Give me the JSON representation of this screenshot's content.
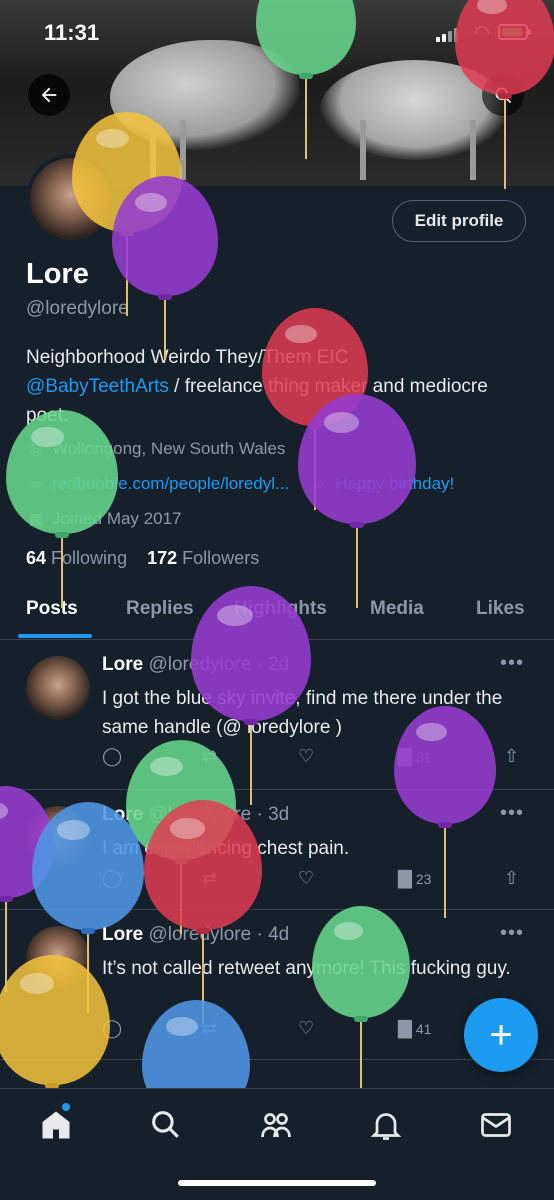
{
  "status_bar": {
    "time": "11:31"
  },
  "profile": {
    "name": "Lore",
    "handle": "@loredylore",
    "edit_label": "Edit profile",
    "bio_line1": "Neighborhood Weirdo They/Them EIC",
    "bio_mention": "@BabyTeethArts",
    "bio_rest": " / freelance thing maker and mediocre poet.",
    "location": "Wollongong, New South Wales",
    "website": "redbubble.com/people/loredyl...",
    "birthday": "Happy birthday!",
    "joined": "Joined May 2017",
    "following_count": "64",
    "following_label": "Following",
    "followers_count": "172",
    "followers_label": "Followers"
  },
  "tabs": [
    {
      "label": "Posts",
      "active": true
    },
    {
      "label": "Replies"
    },
    {
      "label": "Highlights"
    },
    {
      "label": "Media"
    },
    {
      "label": "Likes"
    }
  ],
  "posts": [
    {
      "name": "Lore",
      "handle": "@loredylore",
      "time": "2d",
      "text": "I got the blue sky invite, find me there under the same handle (@ loredylore )",
      "views": "31"
    },
    {
      "name": "Lore",
      "handle": "@loredylore",
      "time": "3d",
      "text": "I am experiencing chest pain.",
      "views": "23"
    },
    {
      "name": "Lore",
      "handle": "@loredylore",
      "time": "4d",
      "text": "It’s not called retweet anymore! This fucking guy.",
      "views": "41"
    }
  ],
  "icons": {
    "back": "arrow-left-icon",
    "search": "search-icon",
    "compose": "plus-icon",
    "nav": [
      "home-icon",
      "search-icon",
      "communities-icon",
      "notifications-icon",
      "messages-icon"
    ]
  },
  "colors": {
    "accent": "#1d9bf0",
    "background": "#15202b"
  }
}
